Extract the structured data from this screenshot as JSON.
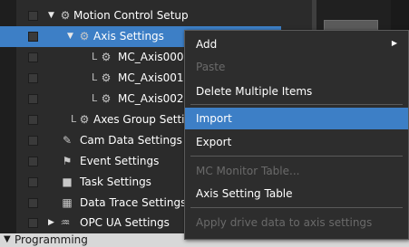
{
  "tree": {
    "items": [
      {
        "label": "Motion Control Setup",
        "expander": "▼",
        "icon": "gear"
      },
      {
        "label": "Axis Settings",
        "expander": "▼",
        "icon": "gear"
      },
      {
        "label": "MC_Axis000",
        "prefix": "L",
        "icon": "gear"
      },
      {
        "label": "MC_Axis001",
        "prefix": "L",
        "icon": "gear"
      },
      {
        "label": "MC_Axis002",
        "prefix": "L",
        "icon": "gear"
      },
      {
        "label": "Axes Group Settings",
        "prefix": "L",
        "icon": "gear"
      },
      {
        "label": "Cam Data Settings",
        "icon": "cam"
      },
      {
        "label": "Event Settings",
        "icon": "flag"
      },
      {
        "label": "Task Settings",
        "icon": "task"
      },
      {
        "label": "Data Trace Settings",
        "icon": "trace"
      },
      {
        "label": "OPC UA Settings",
        "expander": "▶",
        "icon": "opc"
      }
    ],
    "bottom_section": {
      "label": "Programming",
      "expander": "▼"
    }
  },
  "context_menu": {
    "items": [
      {
        "label": "Add",
        "enabled": true,
        "has_submenu": true
      },
      {
        "label": "Paste",
        "enabled": false
      },
      {
        "label": "Delete Multiple Items",
        "enabled": true
      },
      {
        "label": "Import",
        "enabled": true,
        "highlighted": true
      },
      {
        "label": "Export",
        "enabled": true
      },
      {
        "label": "MC Monitor Table...",
        "enabled": false
      },
      {
        "label": "Axis Setting Table",
        "enabled": true
      },
      {
        "label": "Apply drive data to axis settings",
        "enabled": false
      }
    ],
    "submenu_arrow": "▶"
  },
  "colors": {
    "background": "#2b2b2b",
    "selection": "#3d7fc6",
    "menu_background": "#2d2d2d",
    "disabled_text": "#6a6a6a"
  }
}
